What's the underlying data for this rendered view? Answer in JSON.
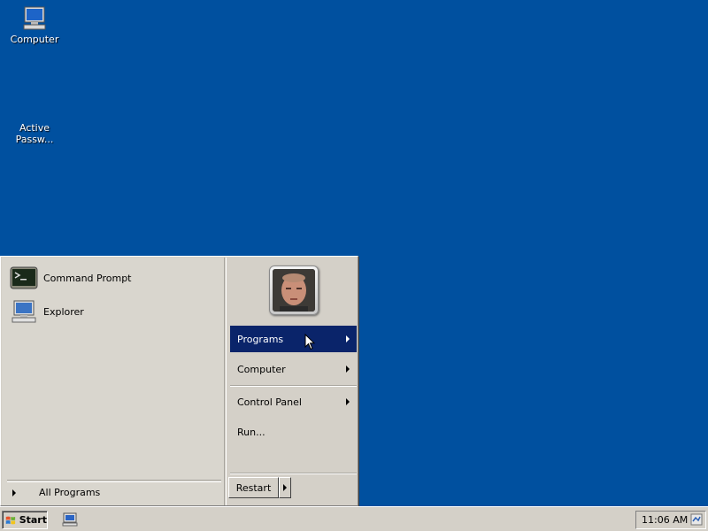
{
  "desktop": {
    "icons": [
      {
        "label": "Computer",
        "icon": "computer-icon"
      },
      {
        "label": "Active\nPassw...",
        "icon": "active-password-icon"
      }
    ]
  },
  "start_menu": {
    "pinned": [
      {
        "label": "Command Prompt",
        "icon": "command-prompt-icon"
      },
      {
        "label": "Explorer",
        "icon": "explorer-icon"
      }
    ],
    "all_programs_label": "All Programs",
    "right_items": [
      {
        "label": "Programs",
        "has_submenu": true,
        "selected": true
      },
      {
        "label": "Computer",
        "has_submenu": true
      },
      {
        "label": "Control Panel",
        "has_submenu": true
      },
      {
        "label": "Run...",
        "has_submenu": false
      }
    ],
    "restart_label": "Restart"
  },
  "taskbar": {
    "start_label": "Start",
    "clock": "11:06 AM"
  },
  "colors": {
    "desktop_bg": "#00509f",
    "menu_bg": "#d4d0c8",
    "selection": "#0a246a"
  }
}
